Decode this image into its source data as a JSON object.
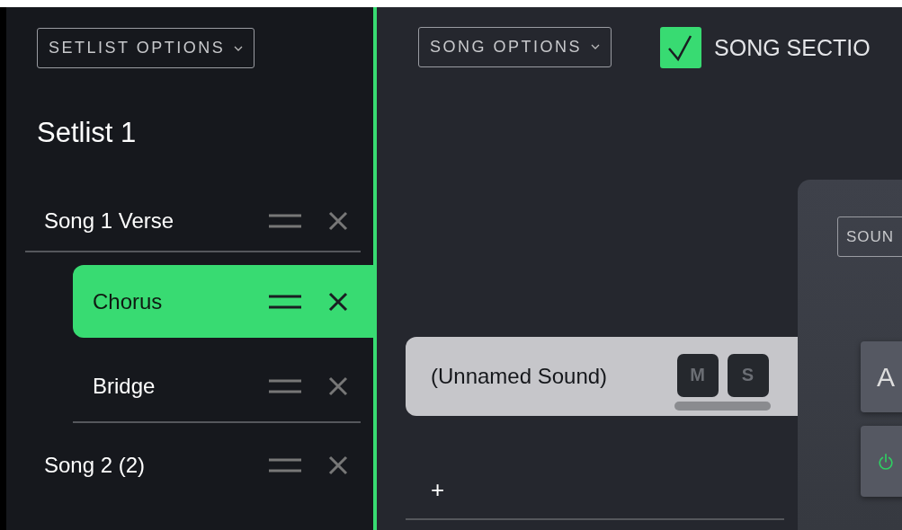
{
  "setlist_options": {
    "label": "SETLIST OPTIONS"
  },
  "setlist": {
    "title": "Setlist 1",
    "songs": [
      {
        "name": "Song 1 Verse",
        "selected": false,
        "children": [
          {
            "name": "Chorus",
            "selected": true
          },
          {
            "name": "Bridge",
            "selected": false
          }
        ]
      },
      {
        "name": "Song 2 (2)",
        "selected": false
      }
    ]
  },
  "song_options": {
    "label": "SONG OPTIONS"
  },
  "song_sections": {
    "label": "SONG SECTIO",
    "checked": true
  },
  "sounds": [
    {
      "name": "(Unnamed Sound)",
      "mute": "M",
      "solo": "S",
      "muted": false,
      "soloed": false
    }
  ],
  "add_sound": "+",
  "sound_panel": {
    "options_label": "SOUN",
    "button_1": "A",
    "power_on": true
  }
}
